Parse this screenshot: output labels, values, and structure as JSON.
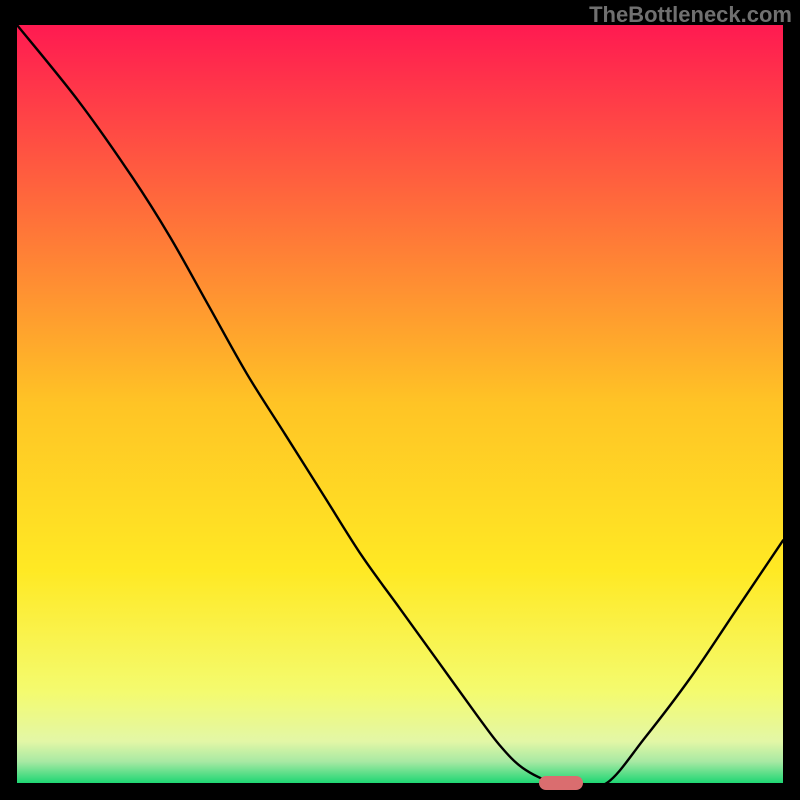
{
  "watermark": "TheBottleneck.com",
  "chart_data": {
    "type": "line",
    "title": "",
    "xlabel": "",
    "ylabel": "",
    "xlim": [
      0,
      100
    ],
    "ylim": [
      0,
      100
    ],
    "x": [
      0,
      8,
      15,
      20,
      25,
      30,
      35,
      40,
      45,
      50,
      55,
      60,
      63,
      66,
      70,
      73,
      77,
      82,
      88,
      94,
      100
    ],
    "y": [
      100,
      90,
      80,
      72,
      63,
      54,
      46,
      38,
      30,
      23,
      16,
      9,
      5,
      2,
      0,
      0,
      0,
      6,
      14,
      23,
      32
    ],
    "gradient_stops": [
      {
        "offset": 0.0,
        "color": "#ff1a51"
      },
      {
        "offset": 0.25,
        "color": "#ff6f3a"
      },
      {
        "offset": 0.5,
        "color": "#ffc425"
      },
      {
        "offset": 0.72,
        "color": "#ffe924"
      },
      {
        "offset": 0.88,
        "color": "#f4fb6f"
      },
      {
        "offset": 0.945,
        "color": "#e3f7a6"
      },
      {
        "offset": 0.972,
        "color": "#a7e9a3"
      },
      {
        "offset": 1.0,
        "color": "#1ed673"
      }
    ],
    "marker": {
      "x": 71,
      "y": 0,
      "color": "#da6d6f"
    }
  }
}
